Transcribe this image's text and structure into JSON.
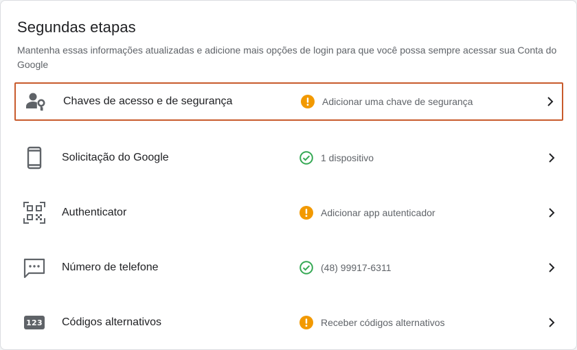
{
  "section": {
    "title": "Segundas etapas",
    "description": "Mantenha essas informações atualizadas e adicione mais opções de login para que você possa sempre acessar sua Conta do Google"
  },
  "items": [
    {
      "label": "Chaves de acesso e de segurança",
      "status": "Adicionar uma chave de segurança",
      "status_type": "warning",
      "icon": "passkey-icon",
      "highlighted": true
    },
    {
      "label": "Solicitação do Google",
      "status": "1 dispositivo",
      "status_type": "ok",
      "icon": "phone-icon",
      "highlighted": false
    },
    {
      "label": "Authenticator",
      "status": "Adicionar app autenticador",
      "status_type": "warning",
      "icon": "qr-code-icon",
      "highlighted": false
    },
    {
      "label": "Número de telefone",
      "status": "(48) 99917-6311",
      "status_type": "ok",
      "icon": "sms-icon",
      "highlighted": false
    },
    {
      "label": "Códigos alternativos",
      "status": "Receber códigos alternativos",
      "status_type": "warning",
      "icon": "backup-codes-icon",
      "highlighted": false,
      "badge_text": "123"
    }
  ],
  "colors": {
    "warning": "#f29900",
    "ok": "#34a853",
    "highlight_border": "#c85a2b"
  }
}
